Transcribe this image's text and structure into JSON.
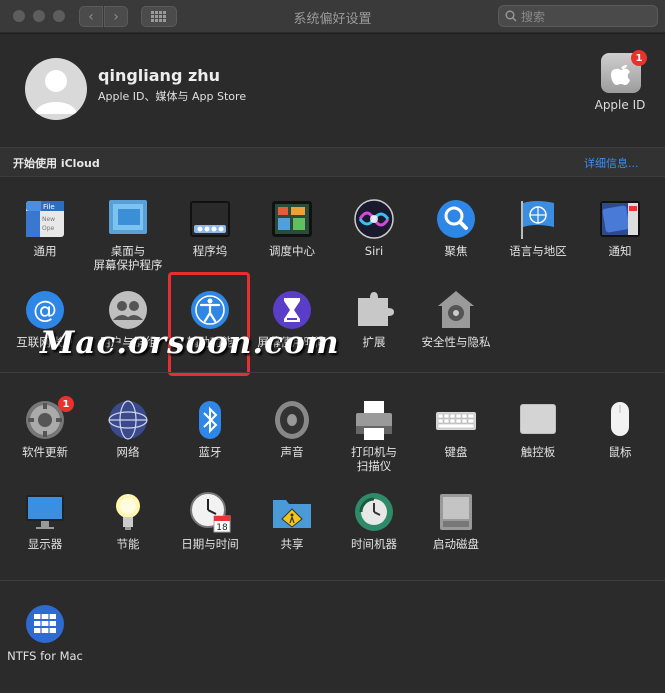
{
  "window": {
    "title": "系统偏好设置",
    "search_placeholder": "搜索",
    "nav_back": "‹",
    "nav_forward": "›"
  },
  "account": {
    "name": "qingliang zhu",
    "subtitle": "Apple ID、媒体与 App Store",
    "apple_id_label": "Apple ID",
    "apple_id_badge": "1"
  },
  "icloud": {
    "text": "开始使用 iCloud",
    "more": "详细信息..."
  },
  "row1": [
    {
      "label": "通用",
      "icon": "general-icon"
    },
    {
      "label": "桌面与\n屏幕保护程序",
      "icon": "desktop-icon"
    },
    {
      "label": "程序坞",
      "icon": "dock-icon"
    },
    {
      "label": "调度中心",
      "icon": "mission-control-icon"
    },
    {
      "label": "Siri",
      "icon": "siri-icon"
    },
    {
      "label": "聚焦",
      "icon": "spotlight-icon"
    },
    {
      "label": "语言与地区",
      "icon": "language-icon"
    },
    {
      "label": "通知",
      "icon": "notifications-icon"
    }
  ],
  "row2": [
    {
      "label": "互联网帐户",
      "icon": "internet-accounts-icon"
    },
    {
      "label": "用户与群组",
      "icon": "users-icon"
    },
    {
      "label": "辅助功能",
      "icon": "accessibility-icon"
    },
    {
      "label": "屏幕使用时间",
      "icon": "screen-time-icon"
    },
    {
      "label": "扩展",
      "icon": "extensions-icon"
    },
    {
      "label": "安全性与隐私",
      "icon": "security-icon"
    }
  ],
  "row3": [
    {
      "label": "软件更新",
      "icon": "software-update-icon",
      "badge": "1"
    },
    {
      "label": "网络",
      "icon": "network-icon"
    },
    {
      "label": "蓝牙",
      "icon": "bluetooth-icon"
    },
    {
      "label": "声音",
      "icon": "sound-icon"
    },
    {
      "label": "打印机与\n扫描仪",
      "icon": "printer-icon"
    },
    {
      "label": "键盘",
      "icon": "keyboard-icon"
    },
    {
      "label": "触控板",
      "icon": "trackpad-icon"
    },
    {
      "label": "鼠标",
      "icon": "mouse-icon"
    }
  ],
  "row4": [
    {
      "label": "显示器",
      "icon": "displays-icon"
    },
    {
      "label": "节能",
      "icon": "energy-icon"
    },
    {
      "label": "日期与时间",
      "icon": "date-time-icon",
      "date": "18"
    },
    {
      "label": "共享",
      "icon": "sharing-icon"
    },
    {
      "label": "时间机器",
      "icon": "time-machine-icon"
    },
    {
      "label": "启动磁盘",
      "icon": "startup-disk-icon"
    }
  ],
  "row5": [
    {
      "label": "NTFS for Mac",
      "icon": "ntfs-icon"
    }
  ],
  "watermark": "Mac.orsoon.com",
  "colors": {
    "accent": "#3e8ef7",
    "highlight": "#e33030",
    "badge": "#e8322e"
  }
}
